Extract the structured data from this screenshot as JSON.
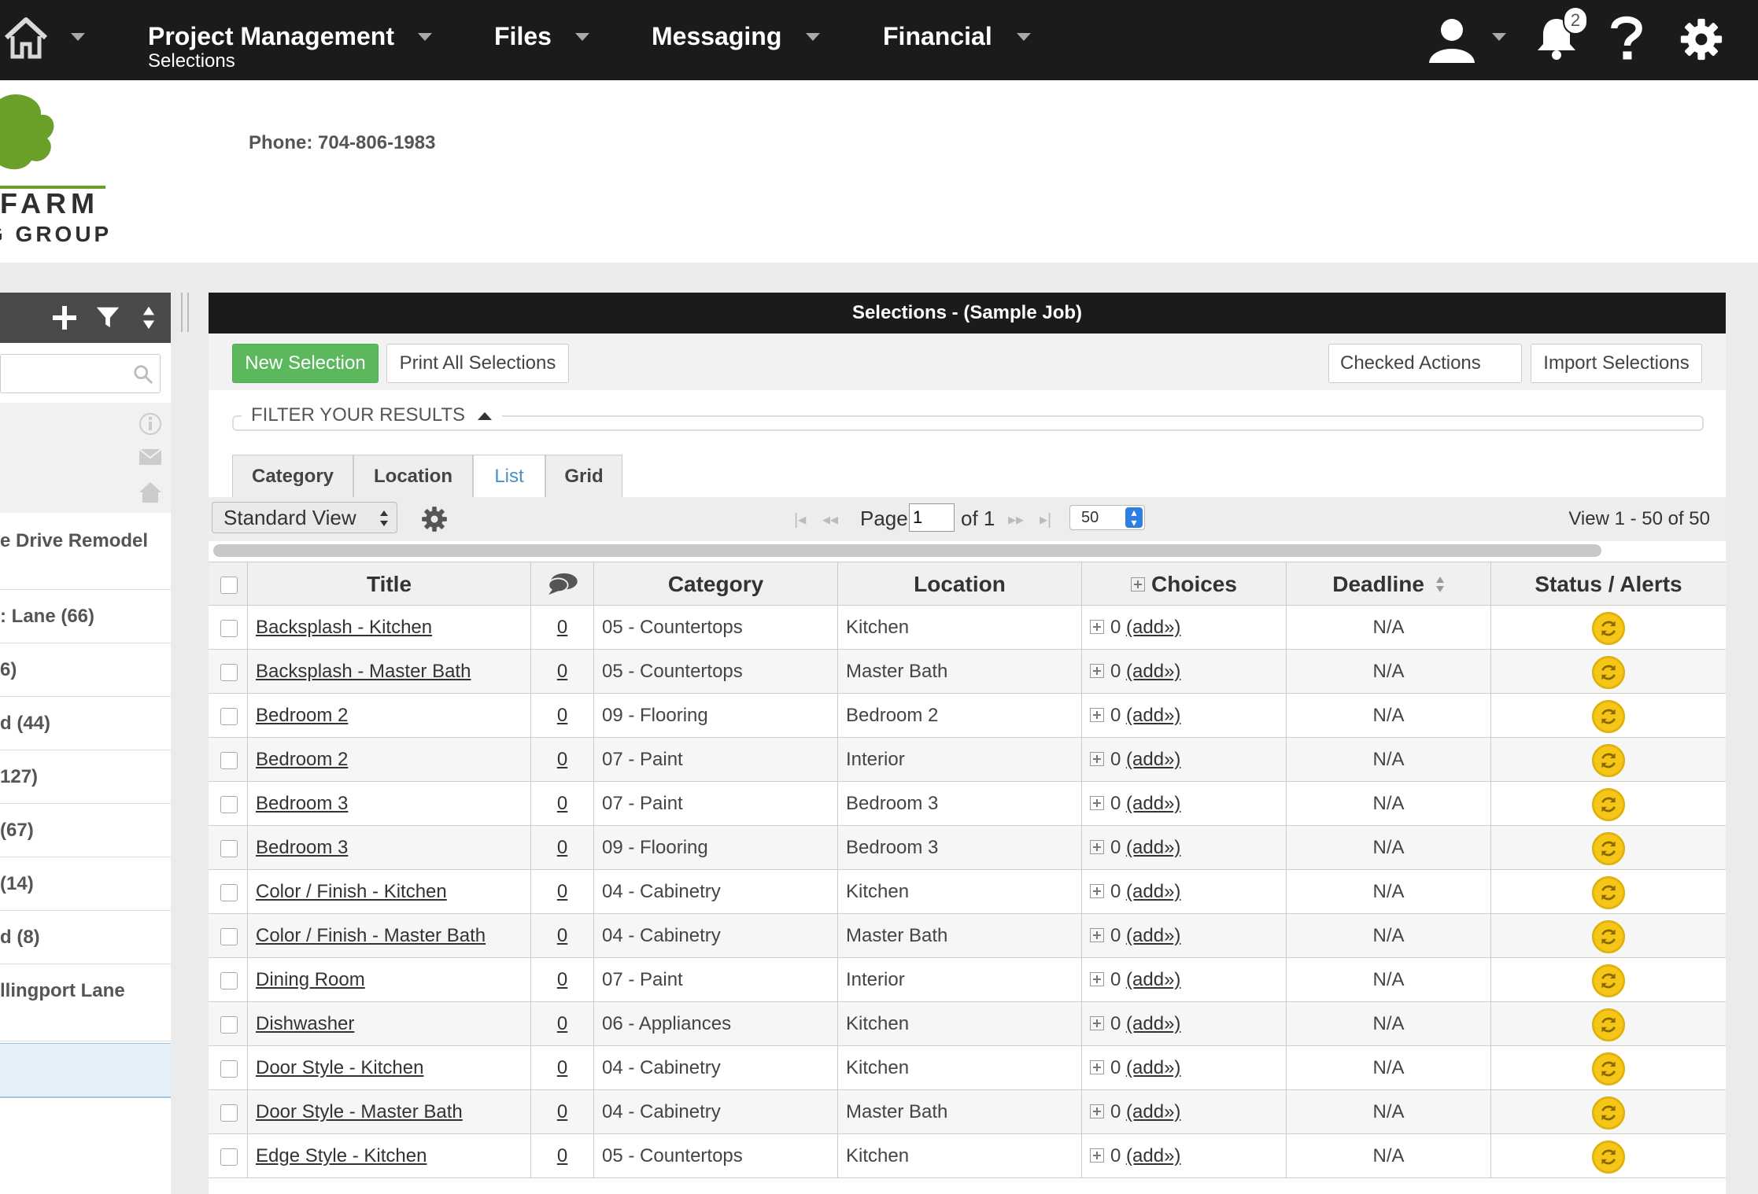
{
  "colors": {
    "topbar": "#1b1b1b",
    "accent_green": "#5cb85c",
    "status_yellow": "#f5c518",
    "tab_active": "#4a90c4"
  },
  "nav": {
    "home_icon": "home-icon",
    "items": [
      {
        "label": "Project Management",
        "sub": "Selections"
      },
      {
        "label": "Files"
      },
      {
        "label": "Messaging"
      },
      {
        "label": "Financial"
      }
    ],
    "notification_count": "2",
    "icons": [
      "user-icon",
      "bell-icon",
      "help-icon",
      "gear-icon"
    ]
  },
  "header": {
    "logo_line1": "FARM",
    "logo_line2": "G GROUP",
    "phone": "Phone: 704-806-1983"
  },
  "left_panel": {
    "items": [
      "e Drive Remodel",
      ": Lane (66)",
      "6)",
      "d (44)",
      "127)",
      "(67)",
      "(14)",
      "d (8)",
      "llingport Lane"
    ]
  },
  "main": {
    "title": "Selections - (Sample Job)",
    "buttons": {
      "new_selection": "New Selection",
      "print_all": "Print All Selections",
      "checked_actions": "Checked Actions",
      "import": "Import Selections"
    },
    "filter_label": "FILTER YOUR RESULTS",
    "tabs": [
      "Category",
      "Location",
      "List",
      "Grid"
    ],
    "active_tab": "List",
    "view_select": "Standard View",
    "pager": {
      "page_label": "Page",
      "page_value": "1",
      "of_label": "of 1",
      "page_size": "50",
      "view_text": "View 1 - 50 of 50"
    }
  },
  "table": {
    "columns": [
      "Title",
      "",
      "Category",
      "Location",
      "Choices",
      "Deadline",
      "Status / Alerts"
    ],
    "rows": [
      {
        "title": "Backsplash - Kitchen",
        "comments": "0",
        "category": "05 - Countertops",
        "location": "Kitchen",
        "choices": "0",
        "add": "(add»)",
        "deadline": "N/A"
      },
      {
        "title": "Backsplash - Master Bath",
        "comments": "0",
        "category": "05 - Countertops",
        "location": "Master Bath",
        "choices": "0",
        "add": "(add»)",
        "deadline": "N/A"
      },
      {
        "title": "Bedroom 2",
        "comments": "0",
        "category": "09 - Flooring",
        "location": "Bedroom 2",
        "choices": "0",
        "add": "(add»)",
        "deadline": "N/A"
      },
      {
        "title": "Bedroom 2",
        "comments": "0",
        "category": "07 - Paint",
        "location": "Interior",
        "choices": "0",
        "add": "(add»)",
        "deadline": "N/A"
      },
      {
        "title": "Bedroom 3",
        "comments": "0",
        "category": "07 - Paint",
        "location": "Bedroom 3",
        "choices": "0",
        "add": "(add»)",
        "deadline": "N/A"
      },
      {
        "title": "Bedroom 3",
        "comments": "0",
        "category": "09 - Flooring",
        "location": "Bedroom 3",
        "choices": "0",
        "add": "(add»)",
        "deadline": "N/A"
      },
      {
        "title": "Color / Finish - Kitchen",
        "comments": "0",
        "category": "04 - Cabinetry",
        "location": "Kitchen",
        "choices": "0",
        "add": "(add»)",
        "deadline": "N/A"
      },
      {
        "title": "Color / Finish - Master Bath",
        "comments": "0",
        "category": "04 - Cabinetry",
        "location": "Master Bath",
        "choices": "0",
        "add": "(add»)",
        "deadline": "N/A"
      },
      {
        "title": "Dining Room",
        "comments": "0",
        "category": "07 - Paint",
        "location": "Interior",
        "choices": "0",
        "add": "(add»)",
        "deadline": "N/A"
      },
      {
        "title": "Dishwasher",
        "comments": "0",
        "category": "06 - Appliances",
        "location": "Kitchen",
        "choices": "0",
        "add": "(add»)",
        "deadline": "N/A"
      },
      {
        "title": "Door Style - Kitchen",
        "comments": "0",
        "category": "04 - Cabinetry",
        "location": "Kitchen",
        "choices": "0",
        "add": "(add»)",
        "deadline": "N/A"
      },
      {
        "title": "Door Style - Master Bath",
        "comments": "0",
        "category": "04 - Cabinetry",
        "location": "Master Bath",
        "choices": "0",
        "add": "(add»)",
        "deadline": "N/A"
      },
      {
        "title": "Edge Style - Kitchen",
        "comments": "0",
        "category": "05 - Countertops",
        "location": "Kitchen",
        "choices": "0",
        "add": "(add»)",
        "deadline": "N/A"
      }
    ]
  }
}
